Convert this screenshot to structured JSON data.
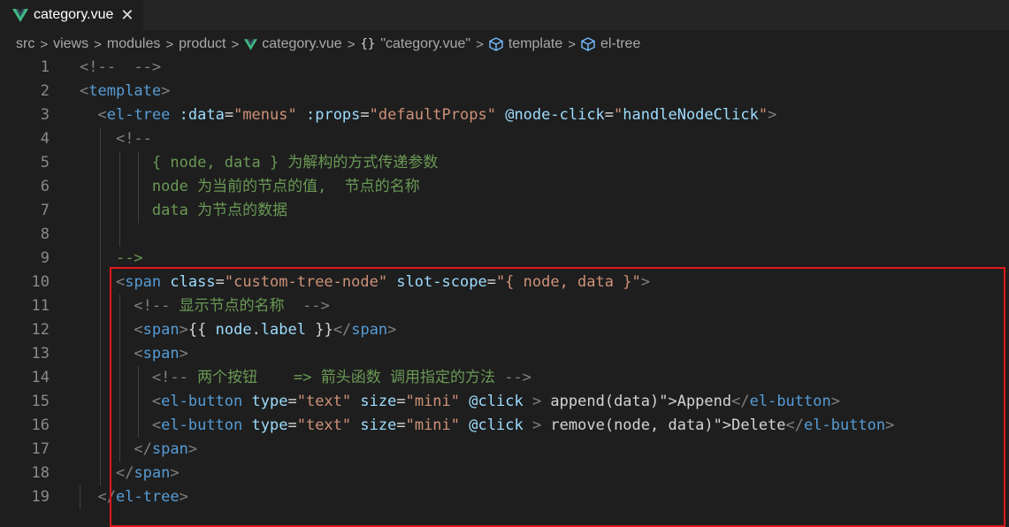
{
  "tab": {
    "title": "category.vue",
    "close": "✕",
    "icon": "vue-icon"
  },
  "breadcrumbs": {
    "items": [
      "src",
      "views",
      "modules",
      "product",
      "category.vue",
      "\"category.vue\"",
      "template",
      "el-tree"
    ],
    "separator": ">",
    "braces": "{}"
  },
  "colors": {
    "background": "#1e1e1e",
    "tag": "#569cd6",
    "attribute": "#9cdcfe",
    "string": "#ce9178",
    "comment": "#6a9955",
    "function": "#dcdcaa",
    "highlight_box": "#e01818"
  },
  "code_lines": [
    {
      "n": "1",
      "text": "<!--  -->"
    },
    {
      "n": "2",
      "text": "<template>"
    },
    {
      "n": "3",
      "text": "  <el-tree :data=\"menus\" :props=\"defaultProps\" @node-click=\"handleNodeClick\">"
    },
    {
      "n": "4",
      "text": "    <!--"
    },
    {
      "n": "5",
      "text": "        { node, data } 为解构的方式传递参数"
    },
    {
      "n": "6",
      "text": "        node 为当前的节点的值,  节点的名称"
    },
    {
      "n": "7",
      "text": "        data 为节点的数据"
    },
    {
      "n": "8",
      "text": ""
    },
    {
      "n": "9",
      "text": "    -->"
    },
    {
      "n": "10",
      "text": "    <span class=\"custom-tree-node\" slot-scope=\"{ node, data }\">"
    },
    {
      "n": "11",
      "text": "      <!-- 显示节点的名称  -->"
    },
    {
      "n": "12",
      "text": "      <span>{{ node.label }}</span>"
    },
    {
      "n": "13",
      "text": "      <span>"
    },
    {
      "n": "14",
      "text": "        <!-- 两个按钮    => 箭头函数 调用指定的方法 -->"
    },
    {
      "n": "15",
      "text": "        <el-button type=\"text\" size=\"mini\" @click=\"() => append(data)\">Append</el-button>"
    },
    {
      "n": "16",
      "text": "        <el-button type=\"text\" size=\"mini\" @click=\"() => remove(node, data)\">Delete</el-button>"
    },
    {
      "n": "17",
      "text": "      </span>"
    },
    {
      "n": "18",
      "text": "    </span>"
    },
    {
      "n": "19",
      "text": "  </el-tree>"
    }
  ]
}
